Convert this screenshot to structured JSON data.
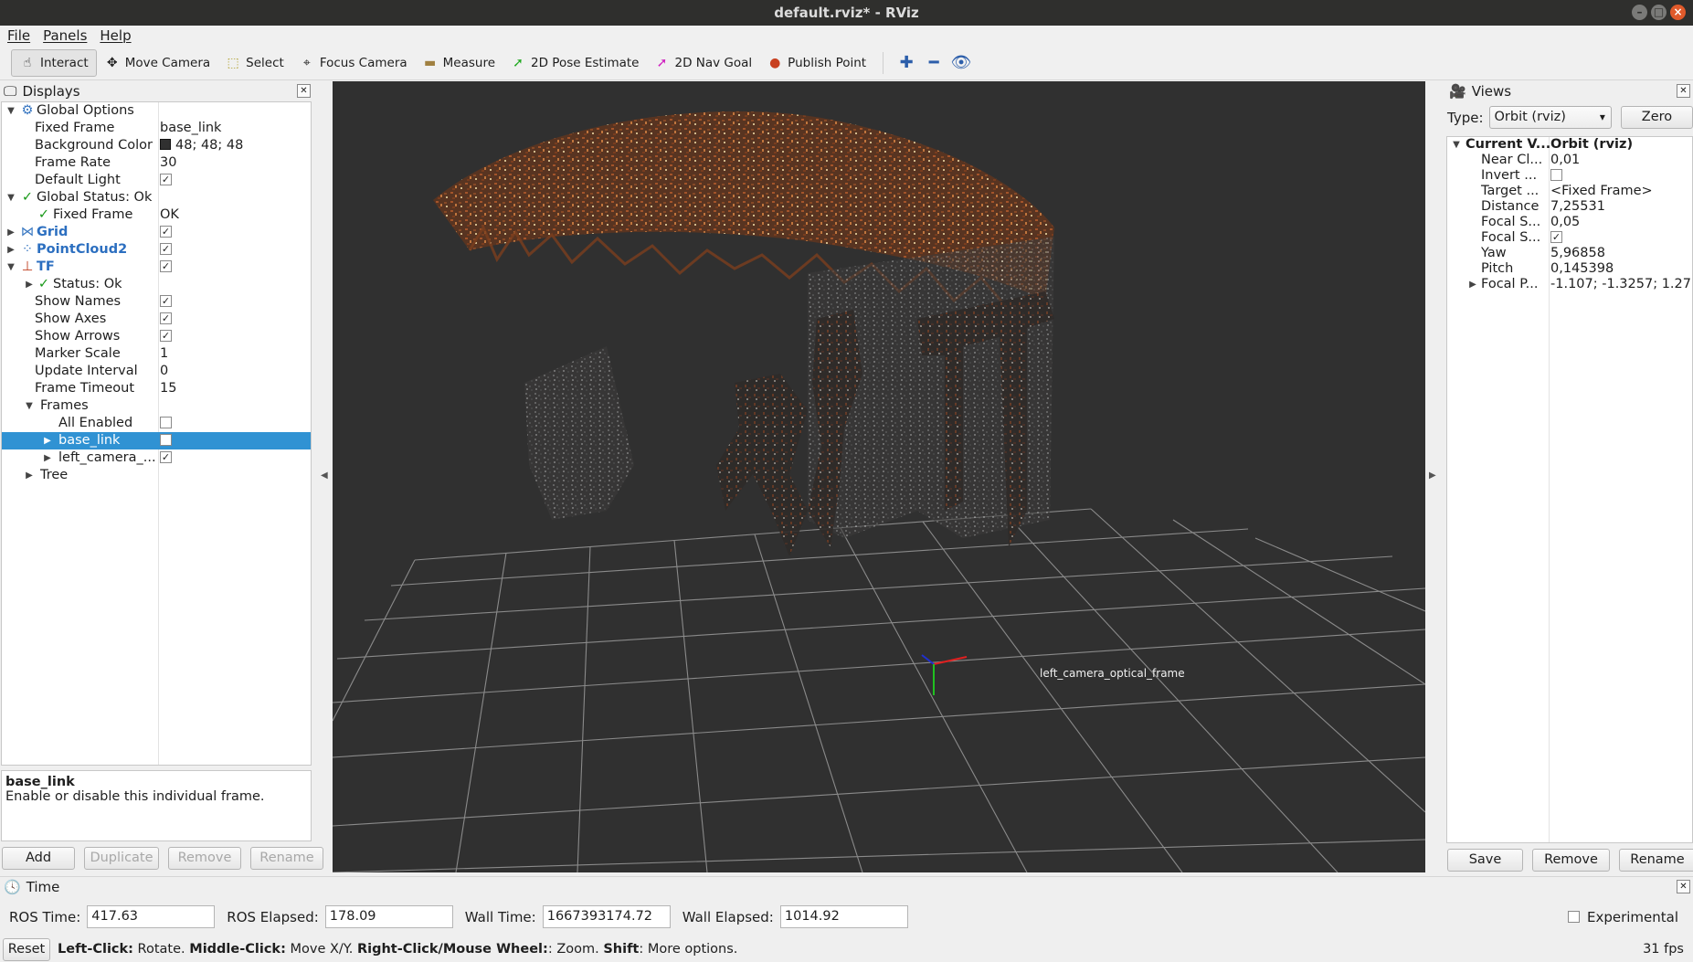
{
  "window": {
    "title": "default.rviz* - RViz"
  },
  "menu": [
    "File",
    "Panels",
    "Help"
  ],
  "toolbar": {
    "tools": [
      {
        "label": "Interact",
        "icon": "interact-icon",
        "active": true
      },
      {
        "label": "Move Camera",
        "icon": "move-camera-icon"
      },
      {
        "label": "Select",
        "icon": "select-icon"
      },
      {
        "label": "Focus Camera",
        "icon": "focus-camera-icon"
      },
      {
        "label": "Measure",
        "icon": "measure-icon"
      },
      {
        "label": "2D Pose Estimate",
        "icon": "pose-estimate-icon"
      },
      {
        "label": "2D Nav Goal",
        "icon": "nav-goal-icon"
      },
      {
        "label": "Publish Point",
        "icon": "publish-point-icon"
      }
    ]
  },
  "displays": {
    "title": "Displays",
    "tree": {
      "global_options": "Global Options",
      "fixed_frame": {
        "label": "Fixed Frame",
        "value": "base_link"
      },
      "background_color": {
        "label": "Background Color",
        "value": "48; 48; 48"
      },
      "frame_rate": {
        "label": "Frame Rate",
        "value": "30"
      },
      "default_light": {
        "label": "Default Light",
        "checked": true
      },
      "global_status": "Global Status: Ok",
      "status_fixed_frame": {
        "label": "Fixed Frame",
        "value": "OK"
      },
      "grid": {
        "label": "Grid",
        "checked": true
      },
      "pointcloud2": {
        "label": "PointCloud2",
        "checked": true
      },
      "tf": {
        "label": "TF",
        "checked": true
      },
      "tf_status": "Status: Ok",
      "show_names": {
        "label": "Show Names",
        "checked": true
      },
      "show_axes": {
        "label": "Show Axes",
        "checked": true
      },
      "show_arrows": {
        "label": "Show Arrows",
        "checked": true
      },
      "marker_scale": {
        "label": "Marker Scale",
        "value": "1"
      },
      "update_interval": {
        "label": "Update Interval",
        "value": "0"
      },
      "frame_timeout": {
        "label": "Frame Timeout",
        "value": "15"
      },
      "frames": "Frames",
      "all_enabled": {
        "label": "All Enabled",
        "checked": false
      },
      "base_link": {
        "label": "base_link",
        "checked": false
      },
      "left_camera": {
        "label": "left_camera_...",
        "checked": true
      },
      "tree": "Tree"
    },
    "description": {
      "title": "base_link",
      "text": "Enable or disable this individual frame."
    },
    "buttons": {
      "add": "Add",
      "duplicate": "Duplicate",
      "remove": "Remove",
      "rename": "Rename"
    }
  },
  "viewport": {
    "frame_label": "left_camera_optical_frame",
    "background": "#303030"
  },
  "views": {
    "title": "Views",
    "type_label": "Type:",
    "type_value": "Orbit (rviz)",
    "zero": "Zero",
    "tree": {
      "current_view": {
        "label": "Current V...",
        "value": "Orbit (rviz)"
      },
      "near_clip": {
        "label": "Near Cl...",
        "value": "0,01"
      },
      "invert": {
        "label": "Invert ...",
        "checked": false
      },
      "target": {
        "label": "Target ...",
        "value": "<Fixed Frame>"
      },
      "distance": {
        "label": "Distance",
        "value": "7,25531"
      },
      "focal_shape_size": {
        "label": "Focal S...",
        "value": "0,05"
      },
      "focal_shape_fixed": {
        "label": "Focal S...",
        "checked": true
      },
      "yaw": {
        "label": "Yaw",
        "value": "5,96858"
      },
      "pitch": {
        "label": "Pitch",
        "value": "0,145398"
      },
      "focal_point": {
        "label": "Focal P...",
        "value": "-1.107; -1.3257; 1.27..."
      }
    },
    "buttons": {
      "save": "Save",
      "remove": "Remove",
      "rename": "Rename"
    }
  },
  "time": {
    "title": "Time",
    "ros_time_label": "ROS Time:",
    "ros_time": "417.63",
    "ros_elapsed_label": "ROS Elapsed:",
    "ros_elapsed": "178.09",
    "wall_time_label": "Wall Time:",
    "wall_time": "1667393174.72",
    "wall_elapsed_label": "Wall Elapsed:",
    "wall_elapsed": "1014.92",
    "experimental": "Experimental"
  },
  "status": {
    "reset": "Reset",
    "hint_parts": [
      {
        "b": "Left-Click:",
        "t": " Rotate. "
      },
      {
        "b": "Middle-Click:",
        "t": " Move X/Y. "
      },
      {
        "b": "Right-Click/Mouse Wheel:",
        "t": ": Zoom. "
      },
      {
        "b": "Shift",
        "t": ": More options."
      }
    ],
    "fps": "31 fps"
  },
  "colors": {
    "accent": "#3092d3",
    "status_ok": "#1a9a1a",
    "display_name": "#2c6fc0",
    "close_button": "#e05a2b"
  }
}
